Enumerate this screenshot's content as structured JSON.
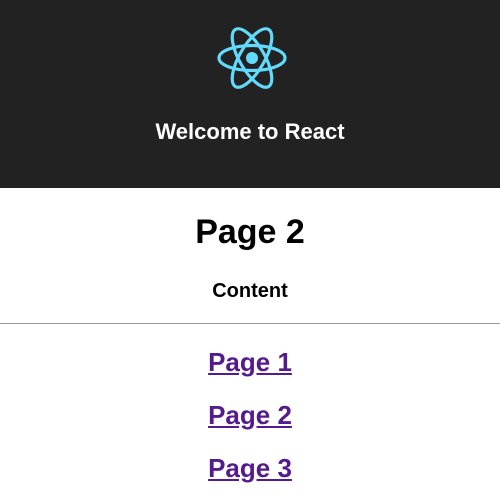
{
  "header": {
    "logo_icon": "react-atom-icon",
    "logo_color": "#61dafb",
    "background": "#222222",
    "title": "Welcome to React"
  },
  "main": {
    "title": "Page 2",
    "content": "Content"
  },
  "nav": {
    "link_color": "#551a8b",
    "links": [
      {
        "label": "Page 1"
      },
      {
        "label": "Page 2"
      },
      {
        "label": "Page 3"
      }
    ]
  }
}
